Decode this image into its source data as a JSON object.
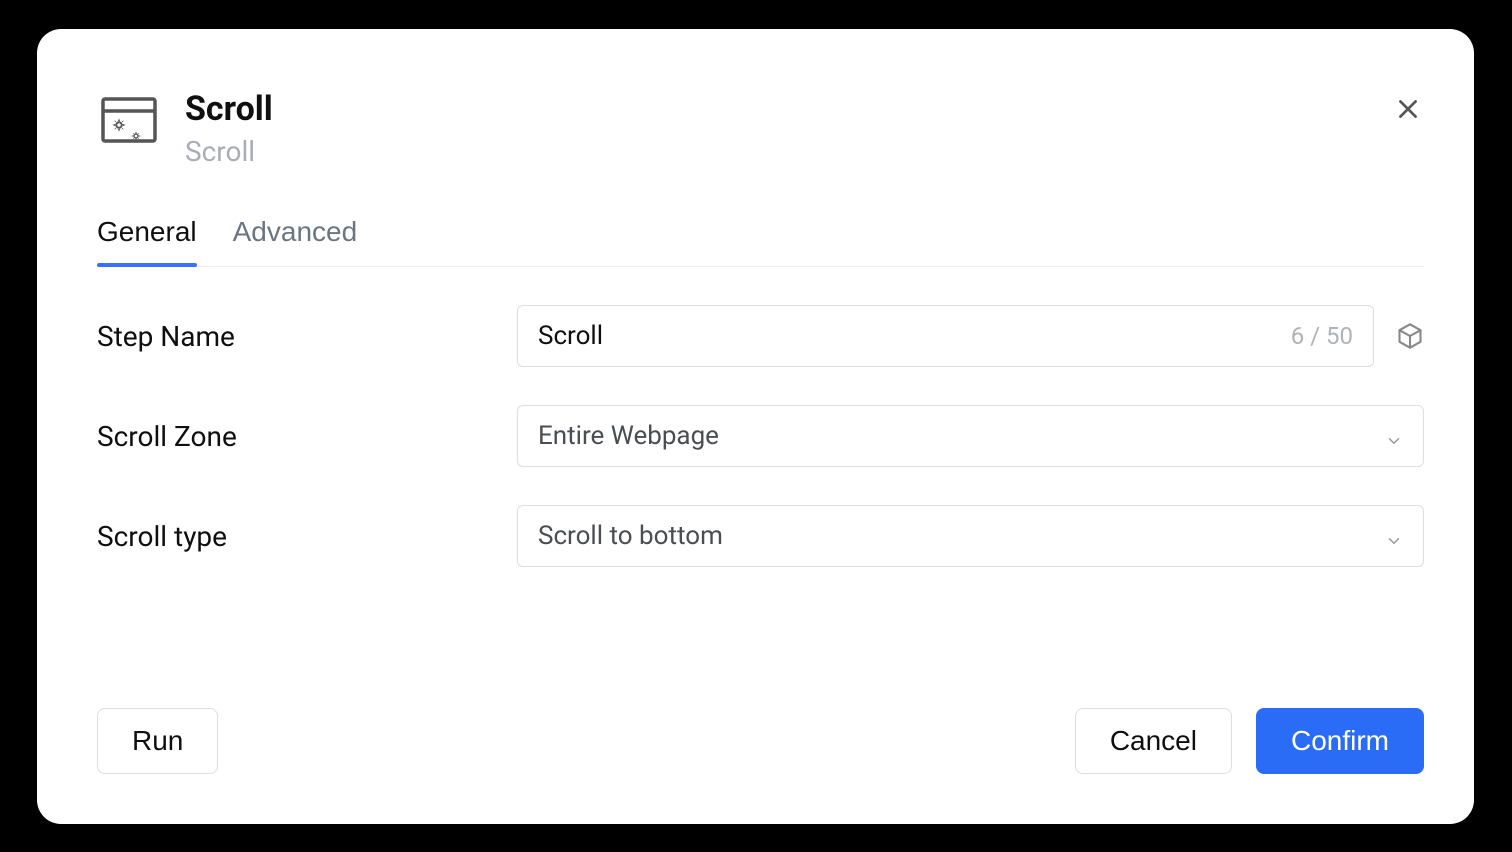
{
  "modal": {
    "title": "Scroll",
    "subtitle": "Scroll"
  },
  "tabs": {
    "general": "General",
    "advanced": "Advanced"
  },
  "fields": {
    "step_name": {
      "label": "Step Name",
      "value": "Scroll",
      "counter": "6 / 50"
    },
    "scroll_zone": {
      "label": "Scroll Zone",
      "value": "Entire Webpage"
    },
    "scroll_type": {
      "label": "Scroll type",
      "value": "Scroll to bottom"
    }
  },
  "buttons": {
    "run": "Run",
    "cancel": "Cancel",
    "confirm": "Confirm"
  }
}
